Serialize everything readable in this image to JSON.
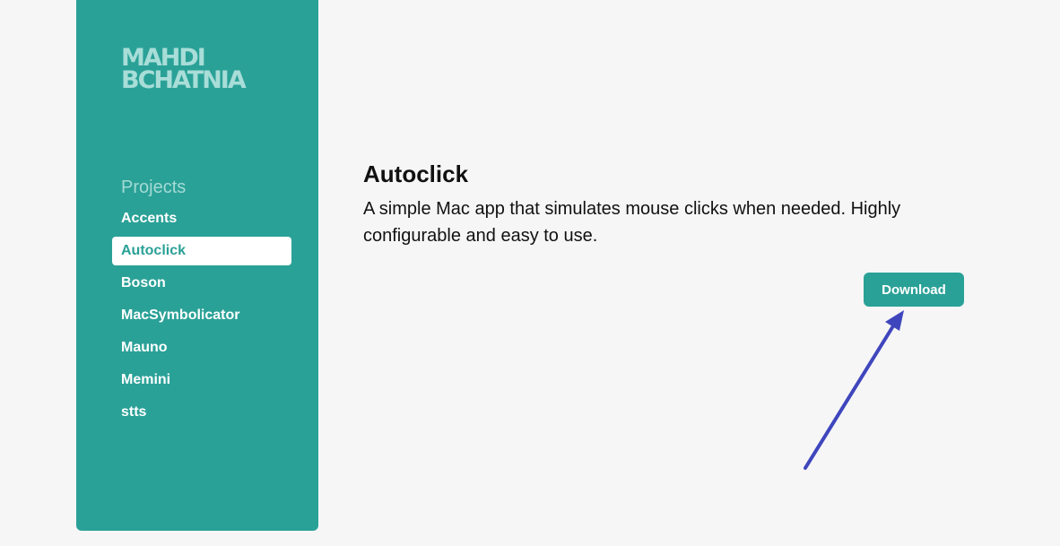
{
  "sidebar": {
    "logo": "MAHDI BCHATNIA",
    "nav_heading": "Projects",
    "items": [
      {
        "label": "Accents",
        "active": false
      },
      {
        "label": "Autoclick",
        "active": true
      },
      {
        "label": "Boson",
        "active": false
      },
      {
        "label": "MacSymbolicator",
        "active": false
      },
      {
        "label": "Mauno",
        "active": false
      },
      {
        "label": "Memini",
        "active": false
      },
      {
        "label": "stts",
        "active": false
      }
    ]
  },
  "main": {
    "title": "Autoclick",
    "description": "A simple Mac app that simulates mouse clicks when needed. Highly configurable and easy to use.",
    "download_label": "Download"
  },
  "colors": {
    "accent": "#2aa197",
    "background": "#f6f6f7",
    "annotation_arrow": "#3f46bd"
  },
  "annotation": {
    "icon": "arrow-icon"
  }
}
